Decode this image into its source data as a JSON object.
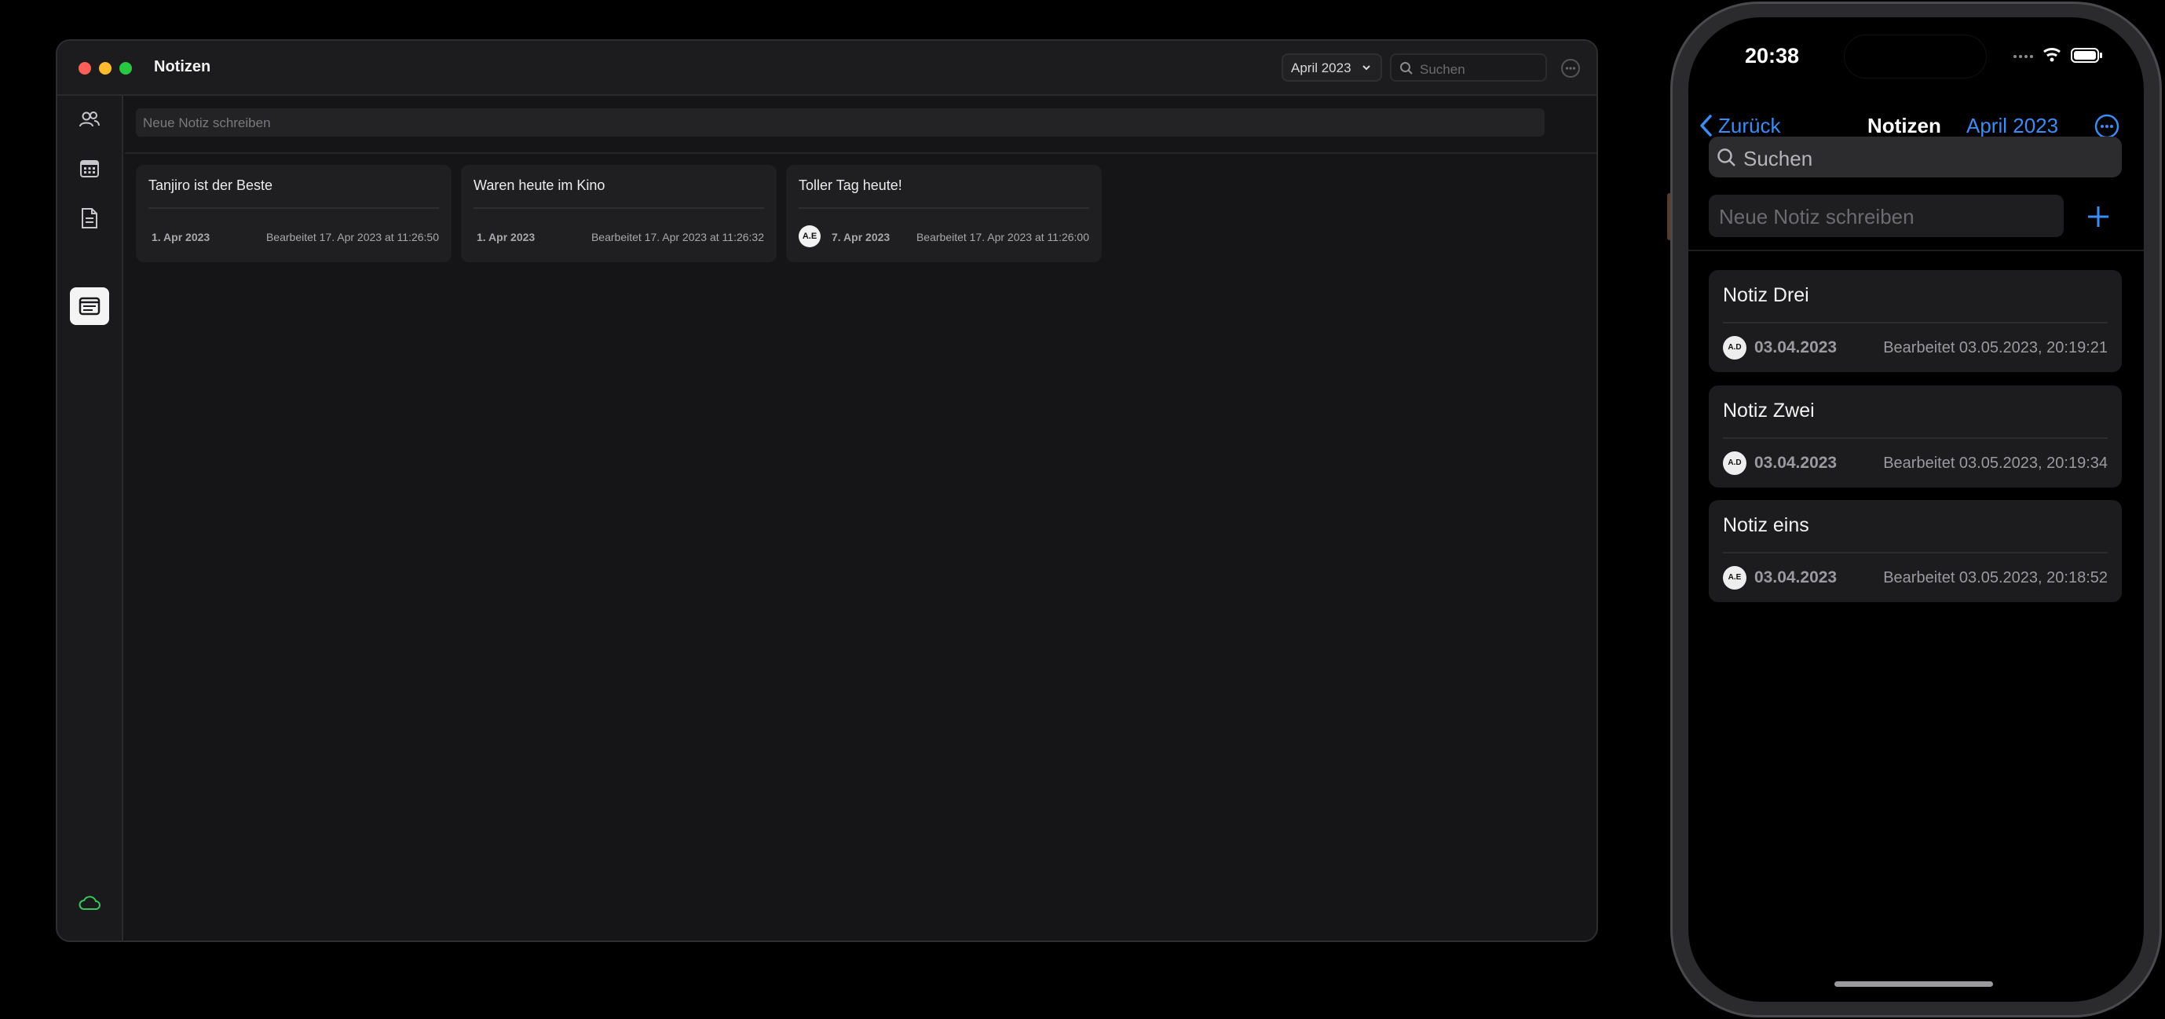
{
  "mac": {
    "title": "Notizen",
    "month": "April 2023",
    "search_placeholder": "Suchen",
    "composer_placeholder": "Neue Notiz schreiben",
    "sidebar": [
      "contacts-icon",
      "calendar-icon",
      "document-icon",
      "notes-icon",
      "cloud-icon",
      "gear-icon"
    ],
    "notes": [
      {
        "title": "Tanjiro ist der Beste",
        "date": "1. Apr 2023",
        "edited": "Bearbeitet 17. Apr 2023 at 11:26:50",
        "avatar": ""
      },
      {
        "title": "Waren heute im Kino",
        "date": "1. Apr 2023",
        "edited": "Bearbeitet 17. Apr 2023 at 11:26:32",
        "avatar": ""
      },
      {
        "title": "Toller Tag heute!",
        "date": "7. Apr 2023",
        "edited": "Bearbeitet 17. Apr 2023 at 11:26:00",
        "avatar": "A.E"
      }
    ]
  },
  "phone": {
    "time": "20:38",
    "back_label": "Zurück",
    "title": "Notizen",
    "month": "April 2023",
    "search_placeholder": "Suchen",
    "composer_placeholder": "Neue Notiz schreiben",
    "notes": [
      {
        "title": "Notiz Drei",
        "avatar": "A.D",
        "date": "03.04.2023",
        "edited": "Bearbeitet 03.05.2023, 20:19:21"
      },
      {
        "title": "Notiz Zwei",
        "avatar": "A.D",
        "date": "03.04.2023",
        "edited": "Bearbeitet 03.05.2023, 20:19:34"
      },
      {
        "title": "Notiz eins",
        "avatar": "A.E",
        "date": "03.04.2023",
        "edited": "Bearbeitet 03.05.2023, 20:18:52"
      }
    ]
  },
  "colors": {
    "accent": "#3b8cf5",
    "cloud": "#34c759",
    "background": "#000000"
  }
}
